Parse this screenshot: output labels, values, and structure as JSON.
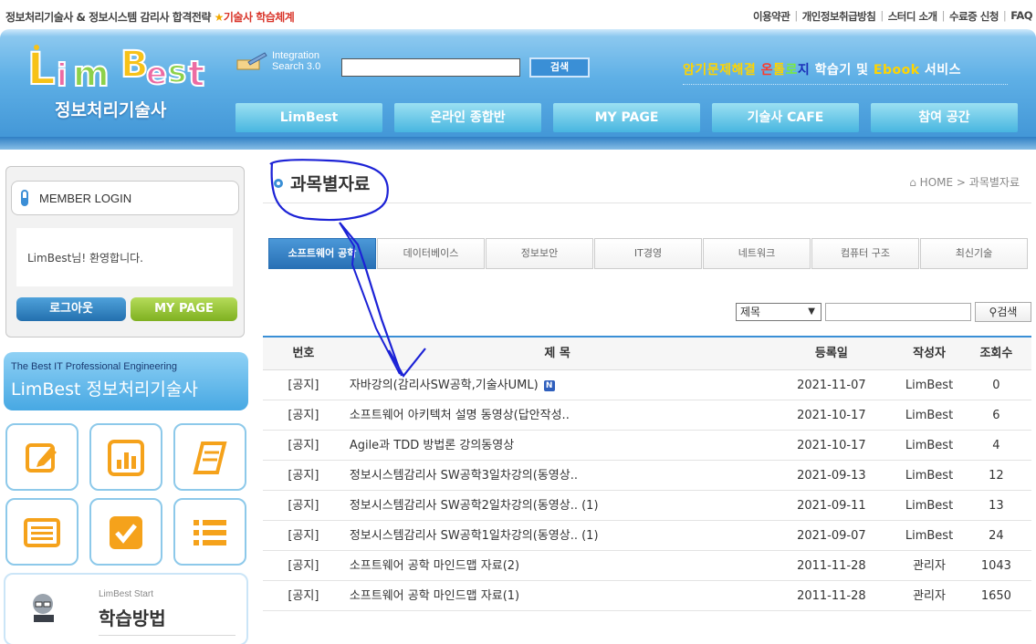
{
  "topbar": {
    "left_text_1": "정보처리기술사 & 정보시스템 감리사 합격전략",
    "left_text_2": "기술사 학습체계",
    "links": [
      "이용약관",
      "개인정보취급방침",
      "스터디 소개",
      "수료증 신청",
      "FAQ"
    ]
  },
  "header": {
    "logo_text": "LimBest",
    "logo_sub": "정보처리기술사",
    "search_label_1": "Integration",
    "search_label_2": "Search 3.0",
    "search_value": "",
    "search_button": "검색",
    "slogan_a": "암기문제해결 ",
    "slogan_b": "온",
    "slogan_c": "톨",
    "slogan_d": "로",
    "slogan_e": "지",
    "slogan_f": " 학습기 및 ",
    "slogan_g": "Ebook",
    "slogan_h": " 서비스",
    "nav": [
      "LimBest",
      "온라인 종합반",
      "MY PAGE",
      "기술사 CAFE",
      "참여 공간"
    ]
  },
  "sidebar": {
    "login_title": "MEMBER LOGIN",
    "welcome": "LimBest님! 환영합니다.",
    "logout": "로그아웃",
    "mypage": "MY PAGE",
    "banner_line1": "The Best IT Professional Engineering",
    "banner_line2": "LimBest 정보처리기술사",
    "study_small": "LimBest Start",
    "study_big": "학습방법",
    "icons": [
      "edit-icon",
      "chart-icon",
      "book-icon",
      "list-icon",
      "check-icon",
      "bullet-list-icon"
    ]
  },
  "main": {
    "title": "과목별자료",
    "breadcrumb_home": "HOME",
    "breadcrumb_sep": ">",
    "breadcrumb_current": "과목별자료",
    "categories": [
      "소프트웨어 공학",
      "데이터베이스",
      "정보보안",
      "IT경영",
      "네트워크",
      "컴퓨터 구조",
      "최신기술"
    ],
    "active_category": 0,
    "search_select": "제목",
    "search_value": "",
    "search_button": "검색"
  },
  "table": {
    "headers": [
      "번호",
      "제 목",
      "등록일",
      "작성자",
      "조회수"
    ],
    "rows": [
      {
        "no": "[공지]",
        "title": "자바강의(감리사SW공학,기술사UML)",
        "new": true,
        "date": "2021-11-07",
        "author": "LimBest",
        "views": "0"
      },
      {
        "no": "[공지]",
        "title": "소프트웨어 아키텍처 설명 동영상(답안작성..",
        "new": false,
        "date": "2021-10-17",
        "author": "LimBest",
        "views": "6"
      },
      {
        "no": "[공지]",
        "title": "Agile과 TDD 방법론 강의동영상",
        "new": false,
        "date": "2021-10-17",
        "author": "LimBest",
        "views": "4"
      },
      {
        "no": "[공지]",
        "title": "정보시스템감리사 SW공학3일차강의(동영상..",
        "new": false,
        "date": "2021-09-13",
        "author": "LimBest",
        "views": "12"
      },
      {
        "no": "[공지]",
        "title": "정보시스템감리사 SW공학2일차강의(동영상.. (1)",
        "new": false,
        "date": "2021-09-11",
        "author": "LimBest",
        "views": "13"
      },
      {
        "no": "[공지]",
        "title": "정보시스템감리사 SW공학1일차강의(동영상.. (1)",
        "new": false,
        "date": "2021-09-07",
        "author": "LimBest",
        "views": "24"
      },
      {
        "no": "[공지]",
        "title": "소프트웨어 공학 마인드맵 자료(2)",
        "new": false,
        "date": "2011-11-28",
        "author": "관리자",
        "views": "1043"
      },
      {
        "no": "[공지]",
        "title": "소프트웨어 공학 마인드맵 자료(1)",
        "new": false,
        "date": "2011-11-28",
        "author": "관리자",
        "views": "1650"
      }
    ],
    "new_badge": "N"
  },
  "colors": {
    "accent": "#3a8fd6",
    "header": "#3d92d4",
    "annotation": "#1c22d6"
  }
}
